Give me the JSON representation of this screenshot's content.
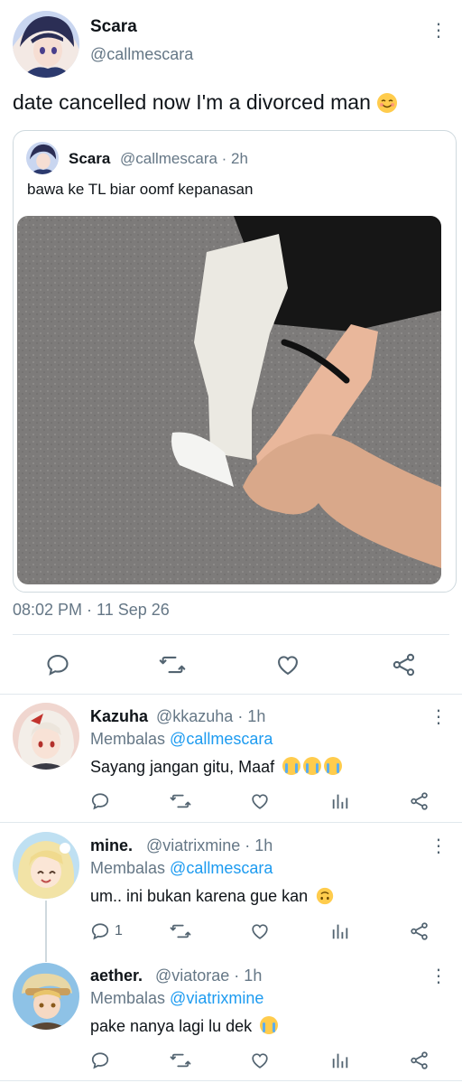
{
  "main_tweet": {
    "name": "Scara",
    "handle": "@callmescara",
    "text": "date cancelled now I'm a divorced man",
    "timestamp": "08:02 PM · 11 Sep 26"
  },
  "quoted_tweet": {
    "name": "Scara",
    "handle_time": "@callmescara · 2h",
    "text": "bawa ke TL biar oomf kepanasan"
  },
  "replies": [
    {
      "name": "Kazuha",
      "handle_time": "@kkazuha · 1h",
      "replying_prefix": "Membalas",
      "replying_to": "@callmescara",
      "text": "Sayang jangan gitu, Maaf",
      "reply_count": ""
    },
    {
      "name": "mine.",
      "handle_time": "@viatrixmine · 1h",
      "replying_prefix": "Membalas",
      "replying_to": "@callmescara",
      "text": "um.. ini bukan karena gue kan",
      "reply_count": "1"
    },
    {
      "name": "aether.",
      "handle_time": "@viatorae · 1h",
      "replying_prefix": "Membalas",
      "replying_to": "@viatrixmine",
      "text": "pake nanya lagi lu dek",
      "reply_count": ""
    }
  ],
  "colors": {
    "accent": "#1d9bf0",
    "secondary_text": "#657786",
    "divider": "#e1e8ed"
  }
}
